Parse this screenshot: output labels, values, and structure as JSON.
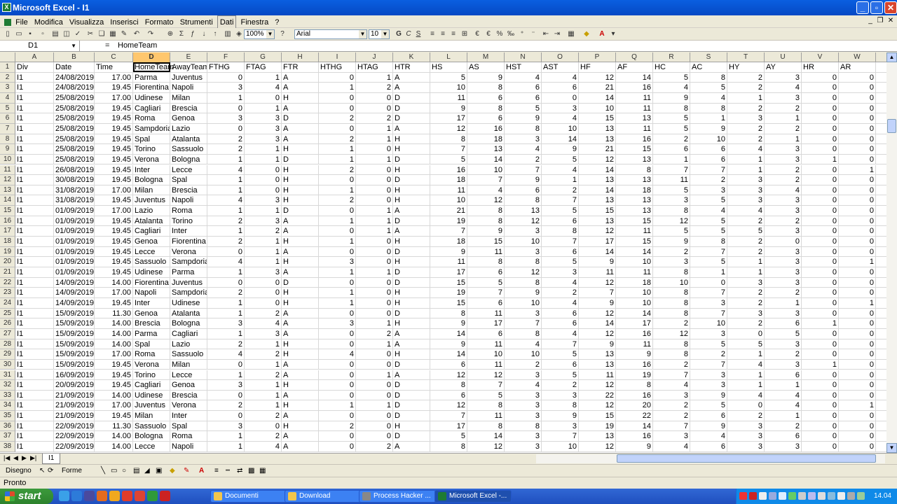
{
  "window": {
    "title": "Microsoft Excel - I1"
  },
  "menu": [
    "File",
    "Modifica",
    "Visualizza",
    "Inserisci",
    "Formato",
    "Strumenti",
    "Dati",
    "Finestra",
    "?"
  ],
  "toolbar": {
    "zoom": "100%",
    "font": "Arial",
    "size": "10"
  },
  "formula_bar": {
    "cell_ref": "D1",
    "equals": "=",
    "content": "HomeTeam"
  },
  "sheet": {
    "columns": [
      "A",
      "B",
      "C",
      "D",
      "E",
      "F",
      "G",
      "H",
      "I",
      "J",
      "K",
      "L",
      "M",
      "N",
      "O",
      "P",
      "Q",
      "R",
      "S",
      "T",
      "U",
      "V",
      "W"
    ],
    "selected_column": "D",
    "header_row": [
      "Div",
      "Date",
      "Time",
      "HomeTeam",
      "AwayTeam",
      "FTHG",
      "FTAG",
      "FTR",
      "HTHG",
      "HTAG",
      "HTR",
      "HS",
      "AS",
      "HST",
      "AST",
      "HF",
      "AF",
      "HC",
      "AC",
      "HY",
      "AY",
      "HR",
      "AR"
    ],
    "rows": [
      [
        "I1",
        "24/08/2019",
        "17.00",
        "Parma",
        "Juventus",
        "0",
        "1",
        "A",
        "0",
        "1",
        "A",
        "5",
        "9",
        "4",
        "4",
        "12",
        "14",
        "5",
        "8",
        "2",
        "3",
        "0",
        "0"
      ],
      [
        "I1",
        "24/08/2019",
        "19.45",
        "Fiorentina",
        "Napoli",
        "3",
        "4",
        "A",
        "1",
        "2",
        "A",
        "10",
        "8",
        "6",
        "6",
        "21",
        "16",
        "4",
        "5",
        "2",
        "4",
        "0",
        "0"
      ],
      [
        "I1",
        "25/08/2019",
        "17.00",
        "Udinese",
        "Milan",
        "1",
        "0",
        "H",
        "0",
        "0",
        "D",
        "11",
        "6",
        "6",
        "0",
        "14",
        "11",
        "9",
        "4",
        "1",
        "3",
        "0",
        "0"
      ],
      [
        "I1",
        "25/08/2019",
        "19.45",
        "Cagliari",
        "Brescia",
        "0",
        "1",
        "A",
        "0",
        "0",
        "D",
        "9",
        "8",
        "5",
        "3",
        "10",
        "11",
        "8",
        "8",
        "2",
        "2",
        "0",
        "0"
      ],
      [
        "I1",
        "25/08/2019",
        "19.45",
        "Roma",
        "Genoa",
        "3",
        "3",
        "D",
        "2",
        "2",
        "D",
        "17",
        "6",
        "9",
        "4",
        "15",
        "13",
        "5",
        "1",
        "3",
        "1",
        "0",
        "0"
      ],
      [
        "I1",
        "25/08/2019",
        "19.45",
        "Sampdoria",
        "Lazio",
        "0",
        "3",
        "A",
        "0",
        "1",
        "A",
        "12",
        "16",
        "8",
        "10",
        "13",
        "11",
        "5",
        "9",
        "2",
        "2",
        "0",
        "0"
      ],
      [
        "I1",
        "25/08/2019",
        "19.45",
        "Spal",
        "Atalanta",
        "2",
        "3",
        "A",
        "2",
        "1",
        "H",
        "8",
        "18",
        "3",
        "14",
        "13",
        "16",
        "2",
        "10",
        "2",
        "1",
        "0",
        "0"
      ],
      [
        "I1",
        "25/08/2019",
        "19.45",
        "Torino",
        "Sassuolo",
        "2",
        "1",
        "H",
        "1",
        "0",
        "H",
        "7",
        "13",
        "4",
        "9",
        "21",
        "15",
        "6",
        "6",
        "4",
        "3",
        "0",
        "0"
      ],
      [
        "I1",
        "25/08/2019",
        "19.45",
        "Verona",
        "Bologna",
        "1",
        "1",
        "D",
        "1",
        "1",
        "D",
        "5",
        "14",
        "2",
        "5",
        "12",
        "13",
        "1",
        "6",
        "1",
        "3",
        "1",
        "0"
      ],
      [
        "I1",
        "26/08/2019",
        "19.45",
        "Inter",
        "Lecce",
        "4",
        "0",
        "H",
        "2",
        "0",
        "H",
        "16",
        "10",
        "7",
        "4",
        "14",
        "8",
        "7",
        "7",
        "1",
        "2",
        "0",
        "1"
      ],
      [
        "I1",
        "30/08/2019",
        "19.45",
        "Bologna",
        "Spal",
        "1",
        "0",
        "H",
        "0",
        "0",
        "D",
        "18",
        "7",
        "9",
        "1",
        "13",
        "13",
        "11",
        "2",
        "3",
        "2",
        "0",
        "0"
      ],
      [
        "I1",
        "31/08/2019",
        "17.00",
        "Milan",
        "Brescia",
        "1",
        "0",
        "H",
        "1",
        "0",
        "H",
        "11",
        "4",
        "6",
        "2",
        "14",
        "18",
        "5",
        "3",
        "3",
        "4",
        "0",
        "0"
      ],
      [
        "I1",
        "31/08/2019",
        "19.45",
        "Juventus",
        "Napoli",
        "4",
        "3",
        "H",
        "2",
        "0",
        "H",
        "10",
        "12",
        "8",
        "7",
        "13",
        "13",
        "3",
        "5",
        "3",
        "3",
        "0",
        "0"
      ],
      [
        "I1",
        "01/09/2019",
        "17.00",
        "Lazio",
        "Roma",
        "1",
        "1",
        "D",
        "0",
        "1",
        "A",
        "21",
        "8",
        "13",
        "5",
        "15",
        "13",
        "8",
        "4",
        "4",
        "3",
        "0",
        "0"
      ],
      [
        "I1",
        "01/09/2019",
        "19.45",
        "Atalanta",
        "Torino",
        "2",
        "3",
        "A",
        "1",
        "1",
        "D",
        "19",
        "8",
        "12",
        "6",
        "13",
        "15",
        "12",
        "5",
        "2",
        "2",
        "0",
        "0"
      ],
      [
        "I1",
        "01/09/2019",
        "19.45",
        "Cagliari",
        "Inter",
        "1",
        "2",
        "A",
        "0",
        "1",
        "A",
        "7",
        "9",
        "3",
        "8",
        "12",
        "11",
        "5",
        "5",
        "5",
        "3",
        "0",
        "0"
      ],
      [
        "I1",
        "01/09/2019",
        "19.45",
        "Genoa",
        "Fiorentina",
        "2",
        "1",
        "H",
        "1",
        "0",
        "H",
        "18",
        "15",
        "10",
        "7",
        "17",
        "15",
        "9",
        "8",
        "2",
        "0",
        "0",
        "0"
      ],
      [
        "I1",
        "01/09/2019",
        "19.45",
        "Lecce",
        "Verona",
        "0",
        "1",
        "A",
        "0",
        "0",
        "D",
        "9",
        "11",
        "3",
        "6",
        "14",
        "14",
        "2",
        "7",
        "2",
        "3",
        "0",
        "0"
      ],
      [
        "I1",
        "01/09/2019",
        "19.45",
        "Sassuolo",
        "Sampdoria",
        "4",
        "1",
        "H",
        "3",
        "0",
        "H",
        "11",
        "8",
        "8",
        "5",
        "9",
        "10",
        "3",
        "5",
        "1",
        "3",
        "0",
        "1"
      ],
      [
        "I1",
        "01/09/2019",
        "19.45",
        "Udinese",
        "Parma",
        "1",
        "3",
        "A",
        "1",
        "1",
        "D",
        "17",
        "6",
        "12",
        "3",
        "11",
        "11",
        "8",
        "1",
        "1",
        "3",
        "0",
        "0"
      ],
      [
        "I1",
        "14/09/2019",
        "14.00",
        "Fiorentina",
        "Juventus",
        "0",
        "0",
        "D",
        "0",
        "0",
        "D",
        "15",
        "5",
        "8",
        "4",
        "12",
        "18",
        "10",
        "0",
        "3",
        "3",
        "0",
        "0"
      ],
      [
        "I1",
        "14/09/2019",
        "17.00",
        "Napoli",
        "Sampdoria",
        "2",
        "0",
        "H",
        "1",
        "0",
        "H",
        "19",
        "7",
        "9",
        "2",
        "7",
        "10",
        "8",
        "7",
        "2",
        "2",
        "0",
        "0"
      ],
      [
        "I1",
        "14/09/2019",
        "19.45",
        "Inter",
        "Udinese",
        "1",
        "0",
        "H",
        "1",
        "0",
        "H",
        "15",
        "6",
        "10",
        "4",
        "9",
        "10",
        "8",
        "3",
        "2",
        "1",
        "0",
        "1"
      ],
      [
        "I1",
        "15/09/2019",
        "11.30",
        "Genoa",
        "Atalanta",
        "1",
        "2",
        "A",
        "0",
        "0",
        "D",
        "8",
        "11",
        "3",
        "6",
        "12",
        "14",
        "8",
        "7",
        "3",
        "3",
        "0",
        "0"
      ],
      [
        "I1",
        "15/09/2019",
        "14.00",
        "Brescia",
        "Bologna",
        "3",
        "4",
        "A",
        "3",
        "1",
        "H",
        "9",
        "17",
        "7",
        "6",
        "14",
        "17",
        "2",
        "10",
        "2",
        "6",
        "1",
        "0"
      ],
      [
        "I1",
        "15/09/2019",
        "14.00",
        "Parma",
        "Cagliari",
        "1",
        "3",
        "A",
        "0",
        "2",
        "A",
        "14",
        "6",
        "8",
        "4",
        "12",
        "16",
        "12",
        "3",
        "0",
        "5",
        "0",
        "0"
      ],
      [
        "I1",
        "15/09/2019",
        "14.00",
        "Spal",
        "Lazio",
        "2",
        "1",
        "H",
        "0",
        "1",
        "A",
        "9",
        "11",
        "4",
        "7",
        "9",
        "11",
        "8",
        "5",
        "5",
        "3",
        "0",
        "0"
      ],
      [
        "I1",
        "15/09/2019",
        "17.00",
        "Roma",
        "Sassuolo",
        "4",
        "2",
        "H",
        "4",
        "0",
        "H",
        "14",
        "10",
        "10",
        "5",
        "13",
        "9",
        "8",
        "2",
        "1",
        "2",
        "0",
        "0"
      ],
      [
        "I1",
        "15/09/2019",
        "19.45",
        "Verona",
        "Milan",
        "0",
        "1",
        "A",
        "0",
        "0",
        "D",
        "6",
        "11",
        "2",
        "6",
        "13",
        "16",
        "2",
        "7",
        "4",
        "3",
        "1",
        "0"
      ],
      [
        "I1",
        "16/09/2019",
        "19.45",
        "Torino",
        "Lecce",
        "1",
        "2",
        "A",
        "0",
        "1",
        "A",
        "12",
        "12",
        "3",
        "5",
        "11",
        "19",
        "7",
        "3",
        "1",
        "6",
        "0",
        "0"
      ],
      [
        "I1",
        "20/09/2019",
        "19.45",
        "Cagliari",
        "Genoa",
        "3",
        "1",
        "H",
        "0",
        "0",
        "D",
        "8",
        "7",
        "4",
        "2",
        "12",
        "8",
        "4",
        "3",
        "1",
        "1",
        "0",
        "0"
      ],
      [
        "I1",
        "21/09/2019",
        "14.00",
        "Udinese",
        "Brescia",
        "0",
        "1",
        "A",
        "0",
        "0",
        "D",
        "6",
        "5",
        "3",
        "3",
        "22",
        "16",
        "3",
        "9",
        "4",
        "4",
        "0",
        "0"
      ],
      [
        "I1",
        "21/09/2019",
        "17.00",
        "Juventus",
        "Verona",
        "2",
        "1",
        "H",
        "1",
        "1",
        "D",
        "12",
        "8",
        "3",
        "8",
        "12",
        "20",
        "2",
        "5",
        "0",
        "4",
        "0",
        "1"
      ],
      [
        "I1",
        "21/09/2019",
        "19.45",
        "Milan",
        "Inter",
        "0",
        "2",
        "A",
        "0",
        "0",
        "D",
        "7",
        "11",
        "3",
        "9",
        "15",
        "22",
        "2",
        "6",
        "2",
        "1",
        "0",
        "0"
      ],
      [
        "I1",
        "22/09/2019",
        "11.30",
        "Sassuolo",
        "Spal",
        "3",
        "0",
        "H",
        "2",
        "0",
        "H",
        "17",
        "8",
        "8",
        "3",
        "19",
        "14",
        "7",
        "9",
        "3",
        "2",
        "0",
        "0"
      ],
      [
        "I1",
        "22/09/2019",
        "14.00",
        "Bologna",
        "Roma",
        "1",
        "2",
        "A",
        "0",
        "0",
        "D",
        "5",
        "14",
        "3",
        "7",
        "13",
        "16",
        "3",
        "4",
        "3",
        "6",
        "0",
        "0"
      ],
      [
        "I1",
        "22/09/2019",
        "14.00",
        "Lecce",
        "Napoli",
        "1",
        "4",
        "A",
        "0",
        "2",
        "A",
        "8",
        "12",
        "3",
        "10",
        "12",
        "9",
        "4",
        "6",
        "3",
        "3",
        "0",
        "0"
      ]
    ],
    "tab": "I1"
  },
  "drawing_toolbar": {
    "draw": "Disegno",
    "shapes": "Forme"
  },
  "status": "Pronto",
  "taskbar": {
    "start": "start",
    "tasks": [
      "Documenti",
      "Download",
      "Process Hacker ...",
      "Microsoft Excel -..."
    ],
    "clock": "14.04"
  },
  "colors": {
    "title_blue": "#0a5fe0",
    "selected_header": "#ffc76e",
    "taskbar_blue": "#245edb",
    "start_green": "#3c9a3c"
  }
}
